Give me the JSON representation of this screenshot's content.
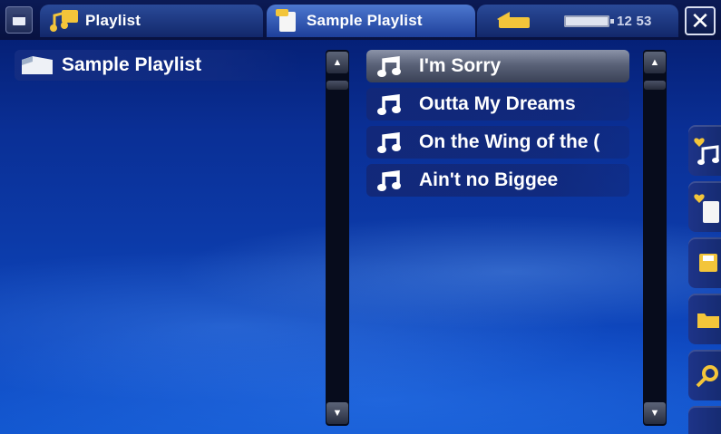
{
  "topbar": {
    "tab_playlist": "Playlist",
    "tab_sample": "Sample Playlist",
    "clock": "12 53"
  },
  "left_panel": {
    "items": [
      {
        "label": "Sample Playlist",
        "icon": "folder-icon"
      }
    ]
  },
  "songs": [
    {
      "title": "I'm Sorry",
      "selected": true
    },
    {
      "title": "Outta My Dreams",
      "selected": false
    },
    {
      "title": "On the Wing of the (",
      "selected": false
    },
    {
      "title": "Ain't no Biggee",
      "selected": false
    }
  ],
  "side_toolbar": [
    {
      "icon": "favorite-music-icon"
    },
    {
      "icon": "favorite-document-icon"
    },
    {
      "icon": "save-icon"
    },
    {
      "icon": "folder-icon"
    },
    {
      "icon": "tools-icon"
    }
  ],
  "colors": {
    "background": "#0c3aa8",
    "topbar": "#081240",
    "selected_row": "#5a6278"
  }
}
